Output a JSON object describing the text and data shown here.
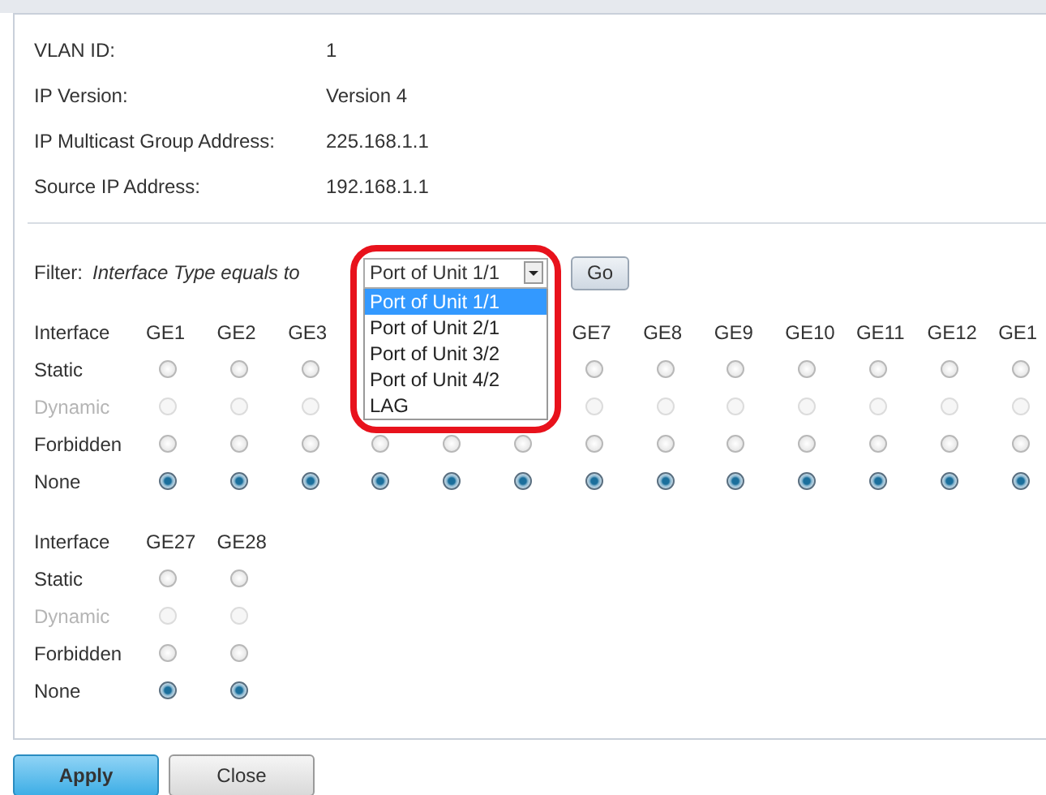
{
  "info": [
    {
      "label": "VLAN ID:",
      "value": "1"
    },
    {
      "label": "IP Version:",
      "value": "Version 4"
    },
    {
      "label": "IP Multicast Group Address:",
      "value": "225.168.1.1"
    },
    {
      "label": "Source IP Address:",
      "value": "192.168.1.1"
    }
  ],
  "filter": {
    "label": "Filter:",
    "condition": "Interface Type equals to",
    "value": "Port of Unit 1/1",
    "go": "Go",
    "options": [
      {
        "label": "Port of Unit 1/1",
        "selected": true
      },
      {
        "label": "Port of Unit 2/1",
        "selected": false
      },
      {
        "label": "Port of Unit 3/2",
        "selected": false
      },
      {
        "label": "Port of Unit 4/2",
        "selected": false
      },
      {
        "label": "LAG",
        "selected": false
      }
    ]
  },
  "groups": [
    {
      "header": "Interface",
      "rows": [
        {
          "kind": "static",
          "label": "Static",
          "disabled": false
        },
        {
          "kind": "dynamic",
          "label": "Dynamic",
          "disabled": true
        },
        {
          "kind": "forbidden",
          "label": "Forbidden",
          "disabled": false
        },
        {
          "kind": "none",
          "label": "None",
          "disabled": false
        }
      ],
      "ports": [
        {
          "label": "GE1",
          "static": false,
          "dynamic": false,
          "forbidden": false,
          "none": true
        },
        {
          "label": "GE2",
          "static": false,
          "dynamic": false,
          "forbidden": false,
          "none": true
        },
        {
          "label": "GE3",
          "static": false,
          "dynamic": false,
          "forbidden": false,
          "none": true
        },
        {
          "forbidden": false,
          "none": true
        },
        {
          "forbidden": false,
          "none": true
        },
        {
          "forbidden": false,
          "none": true
        },
        {
          "label": "GE7",
          "static": false,
          "dynamic": false,
          "forbidden": false,
          "none": true
        },
        {
          "label": "GE8",
          "static": false,
          "dynamic": false,
          "forbidden": false,
          "none": true
        },
        {
          "label": "GE9",
          "static": false,
          "dynamic": false,
          "forbidden": false,
          "none": true
        },
        {
          "label": "GE10",
          "static": false,
          "dynamic": false,
          "forbidden": false,
          "none": true
        },
        {
          "label": "GE11",
          "static": false,
          "dynamic": false,
          "forbidden": false,
          "none": true
        },
        {
          "label": "GE12",
          "static": false,
          "dynamic": false,
          "forbidden": false,
          "none": true
        },
        {
          "label": "GE1",
          "static": false,
          "dynamic": false,
          "forbidden": false,
          "none": true
        }
      ]
    },
    {
      "header": "Interface",
      "rows": [
        {
          "kind": "static",
          "label": "Static",
          "disabled": false
        },
        {
          "kind": "dynamic",
          "label": "Dynamic",
          "disabled": true
        },
        {
          "kind": "forbidden",
          "label": "Forbidden",
          "disabled": false
        },
        {
          "kind": "none",
          "label": "None",
          "disabled": false
        }
      ],
      "ports": [
        {
          "label": "GE27",
          "static": false,
          "dynamic": false,
          "forbidden": false,
          "none": true
        },
        {
          "label": "GE28",
          "static": false,
          "dynamic": false,
          "forbidden": false,
          "none": true
        }
      ]
    }
  ],
  "buttons": [
    {
      "label": "Apply",
      "kind": "primary"
    },
    {
      "label": "Close",
      "kind": "secondary"
    }
  ]
}
